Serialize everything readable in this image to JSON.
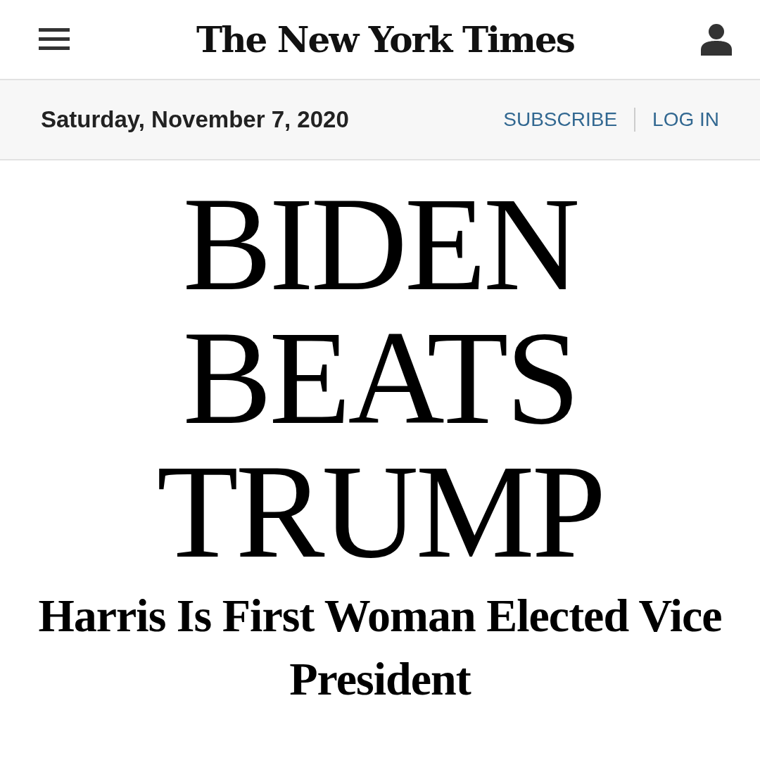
{
  "header": {
    "logo": "The New York Times"
  },
  "date_bar": {
    "date": "Saturday, November 7, 2020",
    "links": [
      "SUBSCRIBE",
      "LOG IN"
    ]
  },
  "headline": [
    "BIDEN",
    "BEATS",
    "TRUMP"
  ],
  "subheadline": "Harris Is First Woman Elected Vice President"
}
